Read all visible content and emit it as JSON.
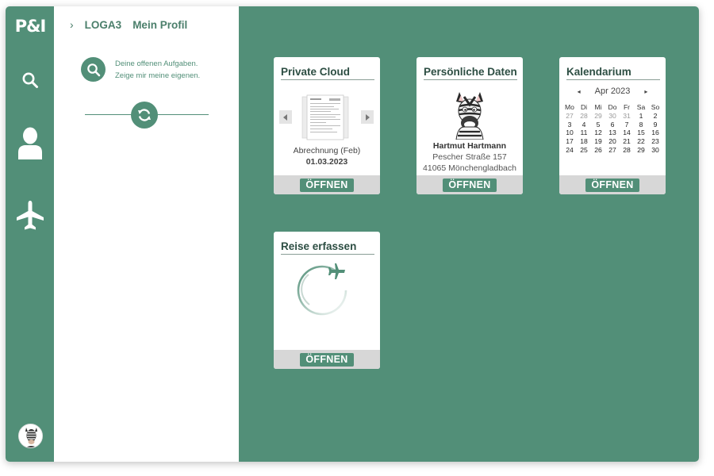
{
  "app": {
    "logo": "P&I"
  },
  "rail": {
    "items": [
      {
        "name": "search",
        "icon": "search-icon"
      },
      {
        "name": "profile",
        "icon": "user-icon"
      },
      {
        "name": "travel",
        "icon": "airplane-icon"
      }
    ],
    "avatar_icon": "zebra-avatar"
  },
  "breadcrumb": {
    "items": [
      "LOGA3",
      "Mein Profil"
    ]
  },
  "tasks": {
    "line1": "Deine offenen Aufgaben.",
    "line2": "Zeige mir meine eigenen."
  },
  "colors": {
    "primary": "#528f78",
    "title": "#2d4e43",
    "footer": "#d7d7d7"
  },
  "tiles": {
    "private_cloud": {
      "title": "Private Cloud",
      "doc_name": "Abrechnung (Feb)",
      "doc_date": "01.03.2023",
      "open": "ÖFFNEN"
    },
    "personal": {
      "title": "Persönliche Daten",
      "name": "Hartmut Hartmann",
      "street": "Pescher Straße 157",
      "city": "41065 Mönchengladbach",
      "open": "ÖFFNEN"
    },
    "calendar": {
      "title": "Kalendarium",
      "month": "Apr 2023",
      "weekdays": [
        "Mo",
        "Di",
        "Mi",
        "Do",
        "Fr",
        "Sa",
        "So"
      ],
      "weeks": [
        [
          "27",
          "28",
          "29",
          "30",
          "31",
          "1",
          "2"
        ],
        [
          "3",
          "4",
          "5",
          "6",
          "7",
          "8",
          "9"
        ],
        [
          "10",
          "11",
          "12",
          "13",
          "14",
          "15",
          "16"
        ],
        [
          "17",
          "18",
          "19",
          "20",
          "21",
          "22",
          "23"
        ],
        [
          "24",
          "25",
          "26",
          "27",
          "28",
          "29",
          "30"
        ]
      ],
      "muted_first_row": 5,
      "open": "ÖFFNEN"
    },
    "travel": {
      "title": "Reise erfassen",
      "open": "ÖFFNEN"
    }
  }
}
